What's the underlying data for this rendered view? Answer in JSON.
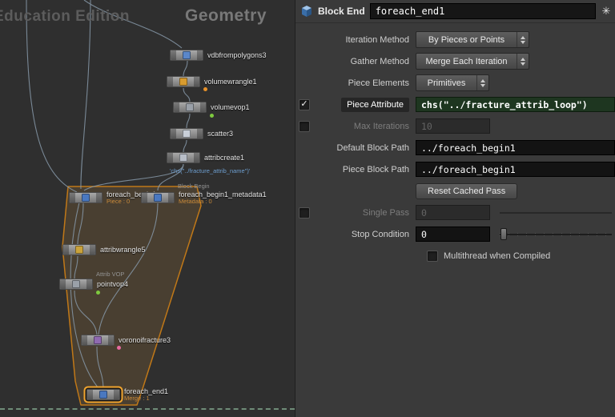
{
  "colors": {
    "accent_orange": "#f0a42e",
    "region_stroke": "#c07818",
    "expression_green": "#1e3620",
    "wire_blue_gray": "#8698a8"
  },
  "icons": {
    "check": "✓",
    "menu": "✳"
  },
  "network": {
    "watermark": "Education Edition",
    "context_label": "Geometry",
    "nodes": [
      {
        "name": "vdbfrompolygons3"
      },
      {
        "name": "volumewrangle1"
      },
      {
        "name": "volumevop1"
      },
      {
        "name": "scatter3"
      },
      {
        "name": "attribcreate1",
        "comment": "'chs(\"../fracture_attrib_name\")'"
      },
      {
        "name": "foreach_begin1",
        "badge": "Piece : 0"
      },
      {
        "name": "foreach_begin1_metadata1",
        "header": "Block Begin",
        "badge": "Metadata : 0"
      },
      {
        "name": "attribwrangle5"
      },
      {
        "name": "pointvop4",
        "header": "Attrib VOP"
      },
      {
        "name": "voronoifracture3"
      },
      {
        "name": "foreach_end1",
        "badge": "Merge : 1"
      }
    ]
  },
  "params": {
    "header": {
      "type_label": "Block End",
      "name_value": "foreach_end1"
    },
    "iteration_method": {
      "label": "Iteration Method",
      "value": "By Pieces or Points"
    },
    "gather_method": {
      "label": "Gather Method",
      "value": "Merge Each Iteration"
    },
    "piece_elements": {
      "label": "Piece Elements",
      "value": "Primitives"
    },
    "piece_attribute": {
      "label": "Piece Attribute",
      "value": "chs(\"../fracture_attrib_loop\")"
    },
    "max_iterations": {
      "label": "Max Iterations",
      "value": "10"
    },
    "default_block_path": {
      "label": "Default Block Path",
      "value": "../foreach_begin1"
    },
    "piece_block_path": {
      "label": "Piece Block Path",
      "value": "../foreach_begin1"
    },
    "reset_button_label": "Reset Cached Pass",
    "single_pass": {
      "label": "Single Pass",
      "value": "0"
    },
    "stop_condition": {
      "label": "Stop Condition",
      "value": "0"
    },
    "multithread": {
      "label": "Multithread when Compiled"
    }
  }
}
